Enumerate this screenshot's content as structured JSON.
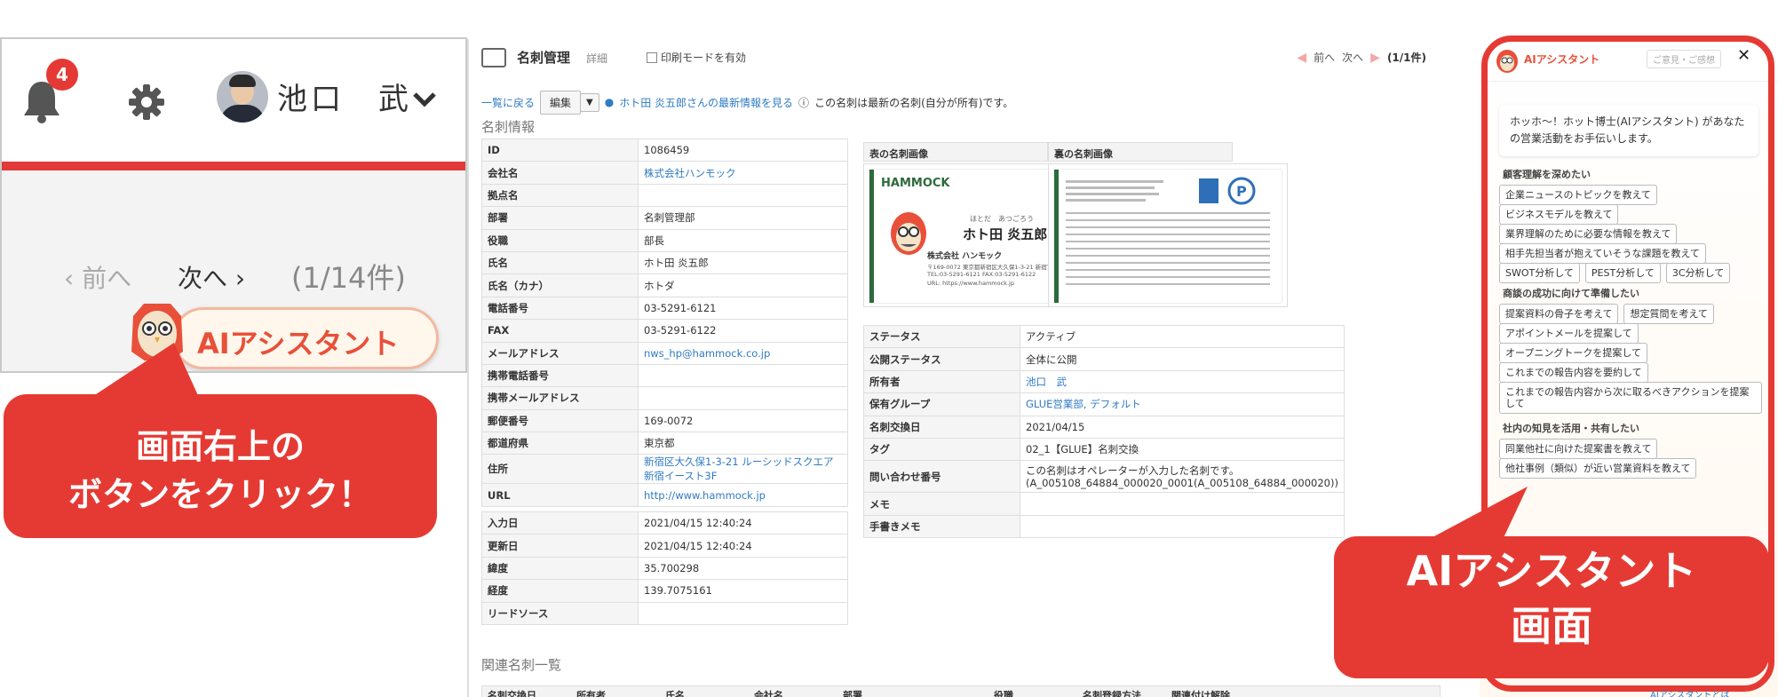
{
  "left_panel": {
    "notification_count": "4",
    "user_name": "池口　武",
    "pager": {
      "prev": "前へ",
      "next": "次へ",
      "count": "(1/14件)"
    },
    "ai_button_label": "AIアシスタント",
    "callout_text_line1": "画面右上の",
    "callout_text_line2": "ボタンをクリック！"
  },
  "main": {
    "title": "名刺管理",
    "title_sub": "詳細",
    "print_mode_label": "印刷モードを有効",
    "top_pager": {
      "prev": "前へ",
      "next": "次へ",
      "count": "(1/1件)"
    },
    "back_link": "一覧に戻る",
    "edit_label": "編集",
    "latest_link": "ホト田 炎五郎さんの最新情報を見る",
    "latest_note": "この名刺は最新の名刺(自分が所有)です。",
    "section_title": "名刺情報",
    "info_rows": [
      {
        "key": "ID",
        "value": "1086459"
      },
      {
        "key": "会社名",
        "value": "株式会社ハンモック"
      },
      {
        "key": "拠点名",
        "value": ""
      },
      {
        "key": "部署",
        "value": "名刺管理部"
      },
      {
        "key": "役職",
        "value": "部長"
      },
      {
        "key": "氏名",
        "value": "ホト田 炎五郎"
      },
      {
        "key": "氏名（カナ）",
        "value": "ホトダ"
      },
      {
        "key": "電話番号",
        "value": "03-5291-6121"
      },
      {
        "key": "FAX",
        "value": "03-5291-6122"
      },
      {
        "key": "メールアドレス",
        "value": "nws_hp@hammock.co.jp"
      },
      {
        "key": "携帯電話番号",
        "value": ""
      },
      {
        "key": "携帯メールアドレス",
        "value": ""
      },
      {
        "key": "郵便番号",
        "value": "169-0072"
      },
      {
        "key": "都道府県",
        "value": "東京都"
      },
      {
        "key": "住所",
        "value": "新宿区大久保1-3-21 ルーシッドスクエア新宿イースト3F"
      },
      {
        "key": "URL",
        "value": "http://www.hammock.jp"
      }
    ],
    "date_rows": [
      {
        "key": "入力日",
        "value": "2021/04/15 12:40:24"
      },
      {
        "key": "更新日",
        "value": "2021/04/15 12:40:24"
      },
      {
        "key": "緯度",
        "value": "35.700298"
      },
      {
        "key": "経度",
        "value": "139.7075161"
      },
      {
        "key": "リードソース",
        "value": ""
      }
    ],
    "front_image_label": "表の名刺画像",
    "back_image_label": "裏の名刺画像",
    "card": {
      "logo": "HAMMOCK",
      "name": "ホト田 炎五郎",
      "furigana": "ほとだ　あつごろう",
      "company": "株式会社 ハンモック",
      "address": "〒169-0072 東京都新宿区大久保1-3-21 新宿TXビル3F",
      "tel": "TEL:03-5291-6121  FAX:03-5291-6122",
      "url": "URL: https://www.hammock.jp"
    },
    "meta_rows": [
      {
        "key": "ステータス",
        "value": "アクティブ"
      },
      {
        "key": "公開ステータス",
        "value": "全体に公開"
      },
      {
        "key": "所有者",
        "value": "池口　武"
      },
      {
        "key": "保有グループ",
        "value": "GLUE営業部, デフォルト"
      },
      {
        "key": "名刺交換日",
        "value": "2021/04/15"
      },
      {
        "key": "タグ",
        "value": "02_1【GLUE】名刺交換"
      },
      {
        "key": "問い合わせ番号",
        "value": "この名刺はオペレーターが入力した名刺です。 (A_005108_64884_000020_0001(A_005108_64884_000020))"
      },
      {
        "key": "メモ",
        "value": ""
      },
      {
        "key": "手書きメモ",
        "value": ""
      }
    ],
    "related_title": "関連名刺一覧",
    "related_columns": [
      "名刺交換日",
      "所有者",
      "氏名",
      "会社名",
      "部署",
      "役職",
      "名刺登録方法",
      "関連付け解除"
    ]
  },
  "ai_panel": {
    "title": "AIアシスタント",
    "feedback": "ご意見・ご感想",
    "greeting": "ホッホ～！ホット博士(AIアシスタント) があなたの営業活動をお手伝いします。",
    "sections": [
      {
        "title": "顧客理解を深めたい",
        "chips": [
          "企業ニュースのトピックを教えて",
          "ビジネスモデルを教えて",
          "業界理解のために必要な情報を教えて",
          "相手先担当者が抱えていそうな課題を教えて",
          "SWOT分析して",
          "PEST分析して",
          "3C分析して"
        ]
      },
      {
        "title": "商談の成功に向けて準備したい",
        "chips": [
          "提案資料の骨子を考えて",
          "想定質問を考えて",
          "アポイントメールを提案して",
          "オープニングトークを提案して",
          "これまでの報告内容を要約して",
          "これまでの報告内容から次に取るべきアクションを提案して"
        ]
      },
      {
        "title": "社内の知見を活用・共有したい",
        "chips": [
          "同業他社に向けた提案書を教えて",
          "他社事例（類似）が近い営業資料を教えて"
        ]
      }
    ],
    "footnote": "AIアシスタントとは",
    "callout_line1": "AIアシスタント",
    "callout_line2": "画面"
  },
  "colors": {
    "accent_red": "#e53a33",
    "link_blue": "#2f7bc4",
    "card_green": "#2d6a3d"
  }
}
